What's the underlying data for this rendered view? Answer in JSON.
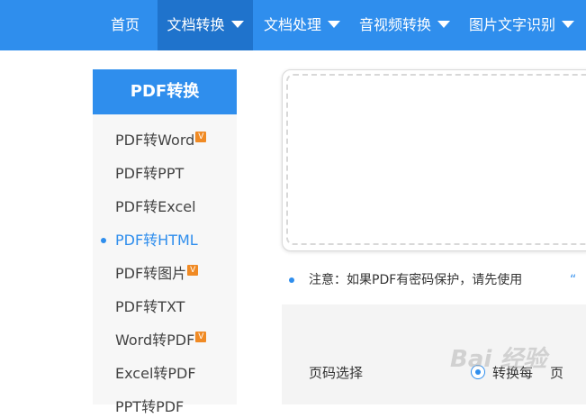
{
  "nav": {
    "items": [
      {
        "label": "首页",
        "dropdown": false,
        "active": false
      },
      {
        "label": "文档转换",
        "dropdown": true,
        "active": true
      },
      {
        "label": "文档处理",
        "dropdown": true,
        "active": false
      },
      {
        "label": "音视频转换",
        "dropdown": true,
        "active": false
      },
      {
        "label": "图片文字识别",
        "dropdown": true,
        "active": false
      }
    ]
  },
  "sidebar": {
    "header": "PDF转换",
    "vip_badge": "V",
    "items": [
      {
        "label": "PDF转Word",
        "vip": true
      },
      {
        "label": "PDF转PPT",
        "vip": false
      },
      {
        "label": "PDF转Excel",
        "vip": false
      },
      {
        "label": "PDF转HTML",
        "vip": false,
        "active": true
      },
      {
        "label": "PDF转图片",
        "vip": true
      },
      {
        "label": "PDF转TXT",
        "vip": false
      },
      {
        "label": "Word转PDF",
        "vip": true
      },
      {
        "label": "Excel转PDF",
        "vip": false
      },
      {
        "label": "PPT转PDF",
        "vip": false
      }
    ]
  },
  "main": {
    "notice": "注意：如果PDF有密码保护，请先使用",
    "notice_link": "“",
    "page_select_label": "页码选择",
    "page_option_text": "转换每",
    "page_option_unit": "页",
    "watermark": "Bai 经验"
  },
  "colors": {
    "primary": "#2f8eed",
    "nav_active": "#1f73cc",
    "vip": "#f08a24"
  }
}
